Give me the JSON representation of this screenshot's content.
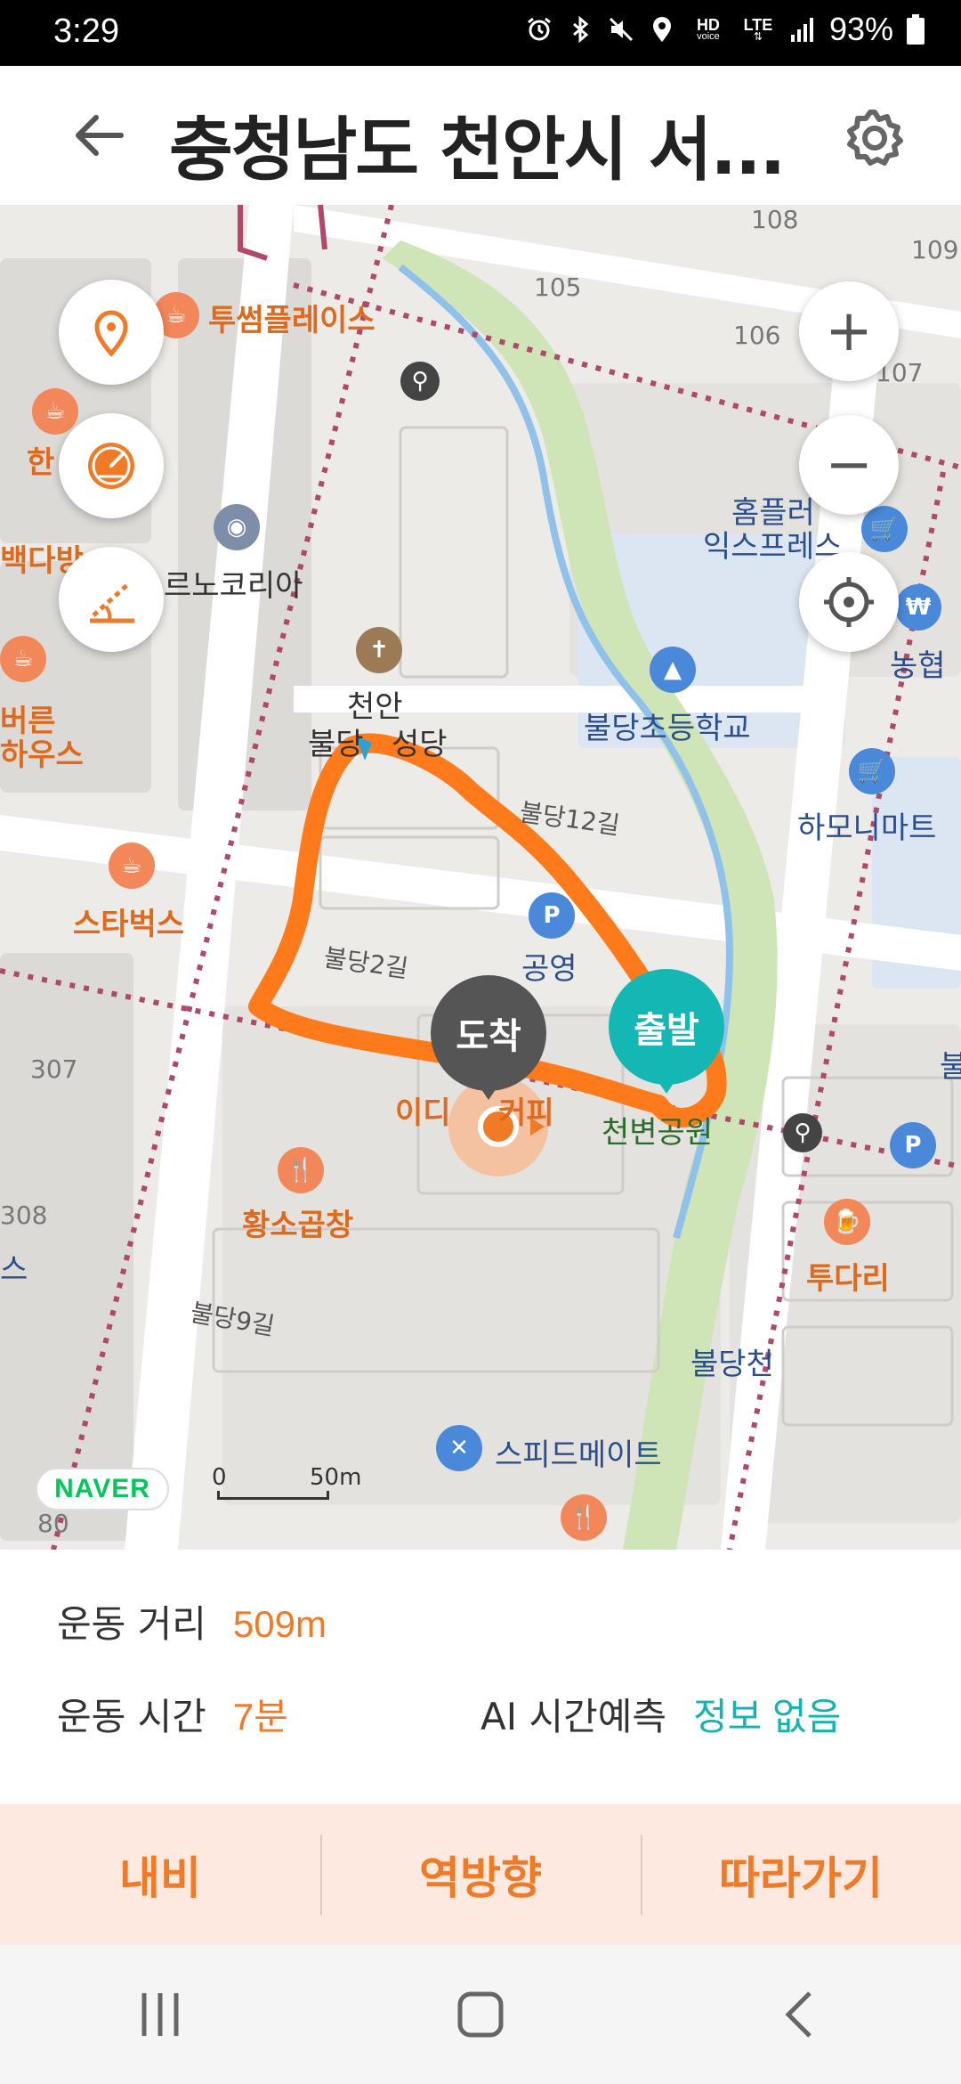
{
  "status_bar": {
    "time": "3:29",
    "hd_label": "HD",
    "voice_label": "voice",
    "lte_label": "LTE",
    "battery": "93%",
    "icons": [
      "alarm-icon",
      "bluetooth-icon",
      "mute-icon",
      "location-icon",
      "signal-icon",
      "battery-icon"
    ]
  },
  "header": {
    "title": "충청남도 천안시 서...",
    "back_icon": "arrow-left-icon",
    "settings_icon": "gear-icon"
  },
  "map": {
    "labels": {
      "cafe1": "투썸플레이스",
      "cafe2": "한",
      "cafe3": "백다방",
      "brand1": "르노코리아",
      "cafe4": "버른",
      "cafe4b": "하우스",
      "starbucks": "스타벅스",
      "church1": "천안",
      "church2": "불당",
      "church2b": "성당",
      "road12": "불당12길",
      "road2": "불당2길",
      "road9": "불당9길",
      "parking": "공영",
      "school": "불당초등학교",
      "homeplus1": "홈플러",
      "homeplus2": "익스프레스",
      "bank": "농협",
      "mart": "하모니마트",
      "park": "천변공원",
      "cafe_near": "이디",
      "cafe_near2": "커피",
      "restaurant": "황소곱창",
      "pub": "투다리",
      "stream": "불당천",
      "speedmate": "스피드메이트",
      "b105": "105",
      "b106": "106",
      "b107": "107",
      "b108": "108",
      "b109": "109",
      "b307": "307",
      "b308": "308",
      "edge1": "불",
      "edge2": "스",
      "b80": "80"
    },
    "markers": {
      "end_label": "도착",
      "start_label": "출발"
    },
    "naver_logo": "NAVER",
    "scale": {
      "zero": "0",
      "distance": "50m"
    },
    "zoom_in": "+",
    "zoom_out": "−"
  },
  "info": {
    "distance_label": "운동 거리",
    "distance_value": "509m",
    "time_label": "운동 시간",
    "time_value": "7분",
    "ai_label": "AI 시간예측",
    "ai_value": "정보 없음"
  },
  "actions": {
    "navi": "내비",
    "reverse": "역방향",
    "follow": "따라가기"
  },
  "colors": {
    "accent_orange": "#f07a26",
    "accent_teal": "#13b3b0",
    "route": "#ff7a1a",
    "action_bg": "#fde9df"
  }
}
